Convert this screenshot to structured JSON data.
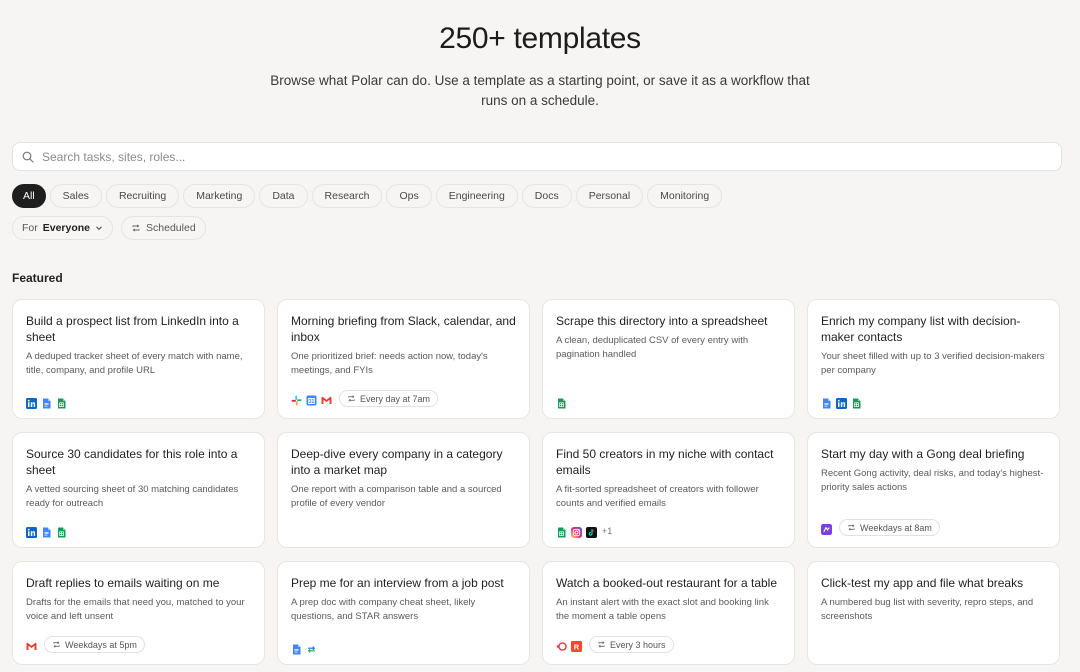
{
  "hero": {
    "title": "250+ templates",
    "subtitle": "Browse what Polar can do. Use a template as a starting point, or save it as a workflow that runs on a schedule."
  },
  "search": {
    "placeholder": "Search tasks, sites, roles..."
  },
  "categories": [
    "All",
    "Sales",
    "Recruiting",
    "Marketing",
    "Data",
    "Research",
    "Ops",
    "Engineering",
    "Docs",
    "Personal",
    "Monitoring"
  ],
  "filters": {
    "for_label": "For",
    "for_value": "Everyone",
    "scheduled_label": "Scheduled"
  },
  "featured_label": "Featured",
  "cards": [
    {
      "title": "Build a prospect list from LinkedIn into a sheet",
      "desc": "A deduped tracker sheet of every match with name, title, company, and profile URL",
      "icons": [
        "linkedin-icon",
        "google-docs-icon",
        "google-sheets-icon"
      ],
      "schedule": ""
    },
    {
      "title": "Morning briefing from Slack, calendar, and inbox",
      "desc": "One prioritized brief: needs action now, today's meetings, and FYIs",
      "icons": [
        "slack-icon",
        "google-calendar-icon",
        "gmail-icon"
      ],
      "schedule": "Every day at 7am"
    },
    {
      "title": "Scrape this directory into a spreadsheet",
      "desc": "A clean, deduplicated CSV of every entry with pagination handled",
      "icons": [
        "google-sheets-icon"
      ],
      "schedule": ""
    },
    {
      "title": "Enrich my company list with decision-maker contacts",
      "desc": "Your sheet filled with up to 3 verified decision-makers per company",
      "icons": [
        "google-docs-icon",
        "linkedin-icon",
        "google-sheets-icon"
      ],
      "schedule": ""
    },
    {
      "title": "Source 30 candidates for this role into a sheet",
      "desc": "A vetted sourcing sheet of 30 matching candidates ready for outreach",
      "icons": [
        "linkedin-icon",
        "google-docs-icon",
        "google-sheets-icon"
      ],
      "schedule": ""
    },
    {
      "title": "Deep-dive every company in a category into a market map",
      "desc": "One report with a comparison table and a sourced profile of every vendor",
      "icons": [],
      "schedule": ""
    },
    {
      "title": "Find 50 creators in my niche with contact emails",
      "desc": "A fit-sorted spreadsheet of creators with follower counts and verified emails",
      "icons": [
        "google-sheets-icon",
        "instagram-icon",
        "tiktok-icon"
      ],
      "more": "+1",
      "schedule": ""
    },
    {
      "title": "Start my day with a Gong deal briefing",
      "desc": "Recent Gong activity, deal risks, and today's highest-priority sales actions",
      "icons": [
        "gong-icon"
      ],
      "schedule": "Weekdays at 8am"
    },
    {
      "title": "Draft replies to emails waiting on me",
      "desc": "Drafts for the emails that need you, matched to your voice and left unsent",
      "icons": [
        "gmail-icon"
      ],
      "schedule": "Weekdays at 5pm"
    },
    {
      "title": "Prep me for an interview from a job post",
      "desc": "A prep doc with company cheat sheet, likely questions, and STAR answers",
      "icons": [
        "google-docs-icon",
        "sync-arrows-icon"
      ],
      "schedule": ""
    },
    {
      "title": "Watch a booked-out restaurant for a table",
      "desc": "An instant alert with the exact slot and booking link the moment a table opens",
      "icons": [
        "opentable-icon",
        "resy-icon"
      ],
      "schedule": "Every 3 hours"
    },
    {
      "title": "Click-test my app and file what breaks",
      "desc": "A numbered bug list with severity, repro steps, and screenshots",
      "icons": [],
      "schedule": ""
    }
  ]
}
